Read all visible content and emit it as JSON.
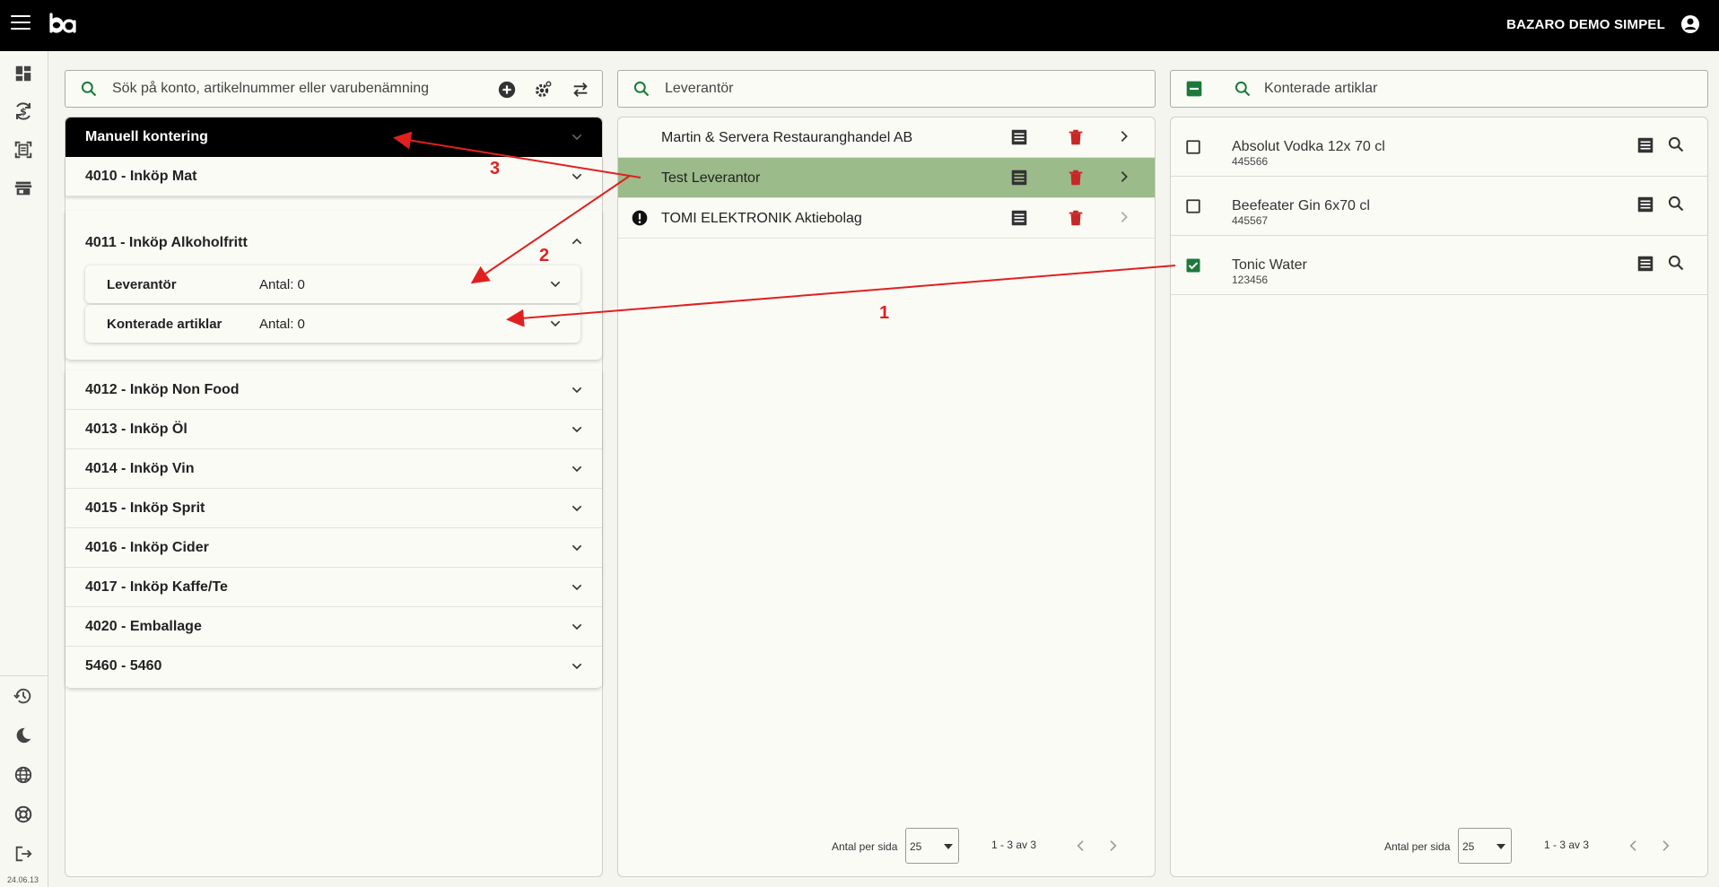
{
  "app": {
    "company": "BAZARO DEMO SIMPEL",
    "version": "24.06.13"
  },
  "icons": {
    "menu": "menu-icon",
    "logo": "ba-logo",
    "account": "account-circle-icon",
    "nav_top": [
      "dashboard-icon",
      "currency-sync-icon",
      "scan-document-icon",
      "storefront-icon"
    ],
    "nav_bottom": [
      "history-icon",
      "dark-mode-icon",
      "language-globe-icon",
      "support-lifebuoy-icon",
      "logout-icon"
    ]
  },
  "colors": {
    "topbar": "#000000",
    "accent_green": "#1b7a3a",
    "selected_row": "#9bbb8a",
    "delete_red": "#c62828",
    "annotation_red": "#e02020"
  },
  "accounts": {
    "search_placeholder": "Sök på konto, artikelnummer eller varubenämning",
    "header": "Manuell kontering",
    "rows_top": [
      "4010 - Inköp Mat"
    ],
    "expanded": {
      "title": "4011 - Inköp Alkoholfritt",
      "subsections": [
        {
          "label": "Leverantör",
          "count": "Antal: 0"
        },
        {
          "label": "Konterade artiklar",
          "count": "Antal: 0"
        }
      ]
    },
    "rows_bottom": [
      "4012 - Inköp Non Food",
      "4013 - Inköp Öl",
      "4014 - Inköp Vin",
      "4015 - Inköp Sprit",
      "4016 - Inköp Cider",
      "4017 - Inköp Kaffe/Te",
      "4020 - Emballage",
      "5460 - 5460"
    ]
  },
  "suppliers": {
    "search_placeholder": "Leverantör",
    "items": [
      {
        "name": "Martin & Servera Restauranghandel AB",
        "selected": false,
        "warning": false
      },
      {
        "name": "Test Leverantor",
        "selected": true,
        "warning": false
      },
      {
        "name": "TOMI ELEKTRONIK Aktiebolag",
        "selected": false,
        "warning": true
      }
    ],
    "pager": {
      "per_page_label": "Antal per sida",
      "per_page": "25",
      "range": "1 - 3 av 3"
    }
  },
  "articles": {
    "search_placeholder": "Konterade artiklar",
    "items": [
      {
        "name": "Absolut Vodka 12x 70 cl",
        "number": "445566",
        "checked": false
      },
      {
        "name": "Beefeater Gin 6x70 cl",
        "number": "445567",
        "checked": false
      },
      {
        "name": "Tonic Water",
        "number": "123456",
        "checked": true
      }
    ],
    "pager": {
      "per_page_label": "Antal per sida",
      "per_page": "25",
      "range": "1 - 3 av 3"
    }
  },
  "annotations": {
    "step1": "1",
    "step2": "2",
    "step3": "3"
  }
}
